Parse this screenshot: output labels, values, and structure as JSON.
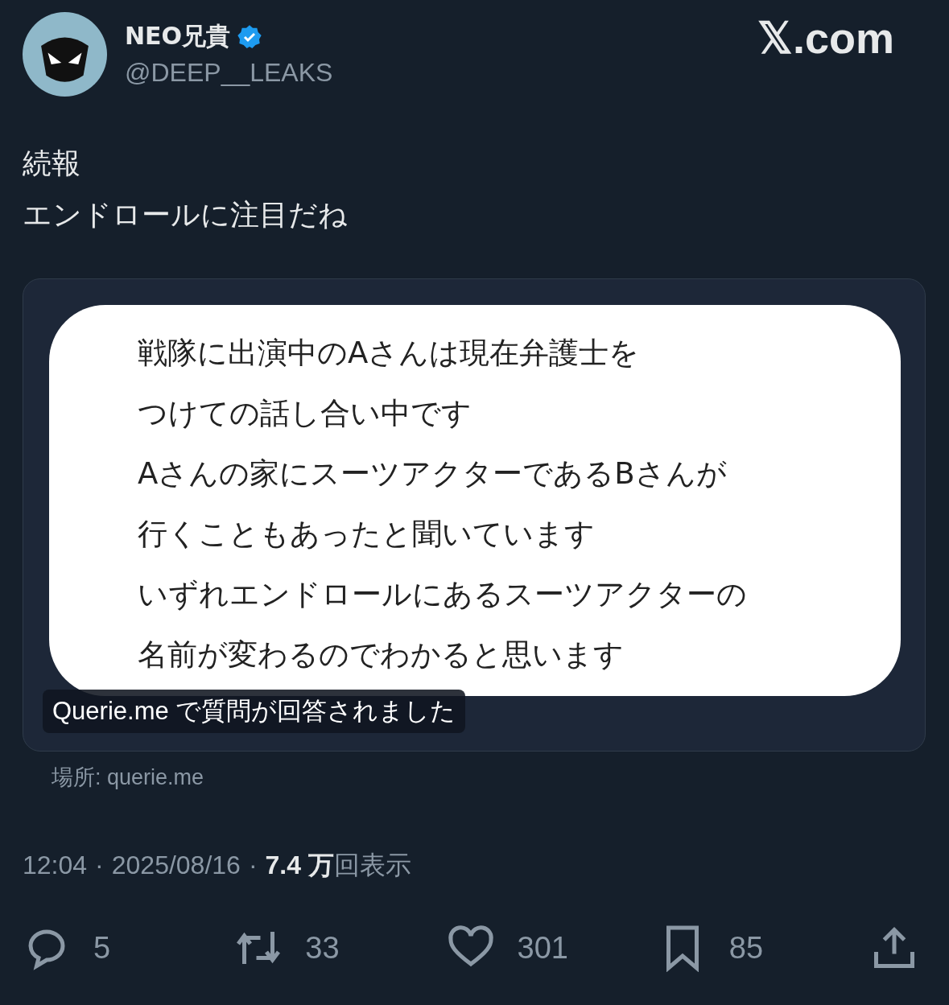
{
  "author": {
    "name": "NEO兄貴",
    "verified": true,
    "handle": "@DEEP__LEAKS"
  },
  "site_logo": "𝕏.com",
  "post_lines": [
    "続報",
    "エンドロールに注目だね"
  ],
  "card": {
    "image_lines": [
      "戦隊に出演中のAさんは現在弁護士を",
      "つけての話し合い中です",
      "Aさんの家にスーツアクターであるBさんが",
      "行くこともあったと聞いています",
      "いずれエンドロールにあるスーツアクターの",
      "名前が変わるのでわかると思います"
    ],
    "caption": "Querie.me で質問が回答されました"
  },
  "source": "場所: querie.me",
  "meta": {
    "time": "12:04",
    "separator": "·",
    "date": "2025/08/16",
    "views": "7.4 万",
    "views_label": "回表示"
  },
  "actions": [
    {
      "kind": "reply",
      "count": "5"
    },
    {
      "kind": "repost",
      "count": "33"
    },
    {
      "kind": "like",
      "count": "301"
    },
    {
      "kind": "bookmark",
      "count": "85"
    },
    {
      "kind": "share"
    }
  ]
}
